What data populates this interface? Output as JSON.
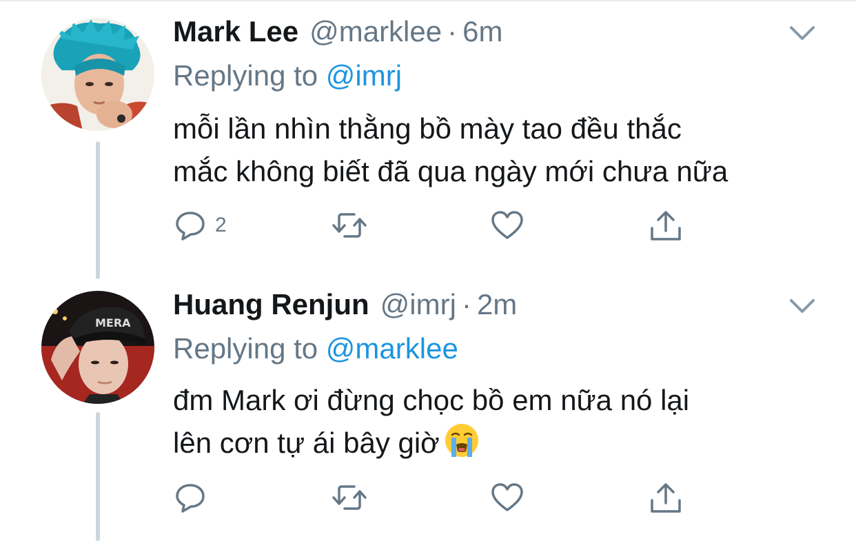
{
  "tweets": [
    {
      "name": "Mark Lee",
      "handle": "@marklee",
      "separator": "·",
      "time": "6m",
      "replying_prefix": "Replying to",
      "replying_to": "@imrj",
      "body_lines": [
        "mỗi lần nhìn thằng bồ mày tao đều thắc",
        "mắc không biết đã qua ngày mới chưa nữa"
      ],
      "reply_count": "2",
      "avatar": "profile-photo-blue-hair",
      "icons": [
        "chevron-down-icon",
        "reply-icon",
        "retweet-icon",
        "like-icon",
        "share-icon"
      ]
    },
    {
      "name": "Huang Renjun",
      "handle": "@imrj",
      "separator": "·",
      "time": "2m",
      "replying_prefix": "Replying to",
      "replying_to": "@marklee",
      "body_lines": [
        "đm Mark ơi đừng chọc bồ em nữa nó lại",
        "lên cơn tự ái bây giờ"
      ],
      "reply_count": "",
      "emoji": "loudly-crying-face",
      "avatar": "profile-photo-black-cap",
      "icons": [
        "chevron-down-icon",
        "reply-icon",
        "retweet-icon",
        "like-icon",
        "share-icon"
      ]
    }
  ],
  "colors": {
    "text": "#14171a",
    "secondary": "#657786",
    "link": "#1b95e0",
    "thread_line": "#ccd6dd",
    "icon": "#657786"
  }
}
